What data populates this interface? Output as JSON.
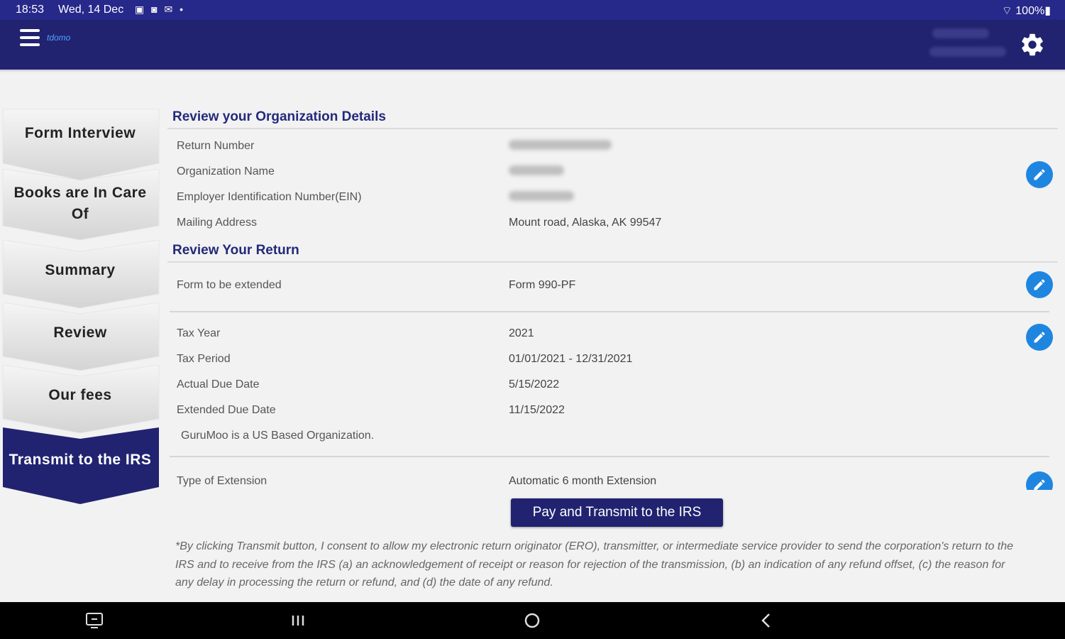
{
  "status": {
    "time": "18:53",
    "date": "Wed, 14 Dec",
    "notifications": "▣ ◙ ✉ •",
    "right": "⌔ 100%▮"
  },
  "app": {
    "logo": "tdomo"
  },
  "sidebar": {
    "steps": [
      {
        "label": "Form Interview"
      },
      {
        "label": "Books are In Care Of"
      },
      {
        "label": "Summary"
      },
      {
        "label": "Review"
      },
      {
        "label": "Our fees"
      },
      {
        "label": "Transmit to the IRS"
      }
    ]
  },
  "org_section": {
    "title": "Review your Organization Details",
    "rows": [
      {
        "label": "Return Number",
        "value": ""
      },
      {
        "label": "Organization Name",
        "value": ""
      },
      {
        "label": "Employer Identification Number(EIN)",
        "value": ""
      },
      {
        "label": "Mailing Address",
        "value": "Mount road, Alaska, AK 99547"
      }
    ]
  },
  "return_section": {
    "title": "Review Your Return",
    "form_label": "Form to be extended",
    "form_value": "Form 990-PF",
    "tax_rows": [
      {
        "label": "Tax Year",
        "value": "2021"
      },
      {
        "label": "Tax Period",
        "value": "01/01/2021 - 12/31/2021"
      },
      {
        "label": "Actual Due Date",
        "value": "5/15/2022"
      },
      {
        "label": "Extended Due Date",
        "value": "11/15/2022"
      }
    ],
    "org_note": "GuruMoo is a US Based Organization.",
    "extension_label": "Type of Extension",
    "extension_value": "Automatic 6 month Extension"
  },
  "pay_button": "Pay and Transmit to the IRS",
  "disclaimer": "*By clicking Transmit button, I consent to allow my electronic return originator (ERO), transmitter, or intermediate service provider to send the corporation's return to the IRS and to receive from the IRS (a) an acknowledgement of receipt or reason for rejection of the transmission, (b) an indication of any refund offset, (c) the reason for any delay in processing the return or refund, and (d) the date of any refund.",
  "colors": {
    "primary": "#212370",
    "status_bar": "#26288a",
    "accent": "#1f86e0"
  }
}
